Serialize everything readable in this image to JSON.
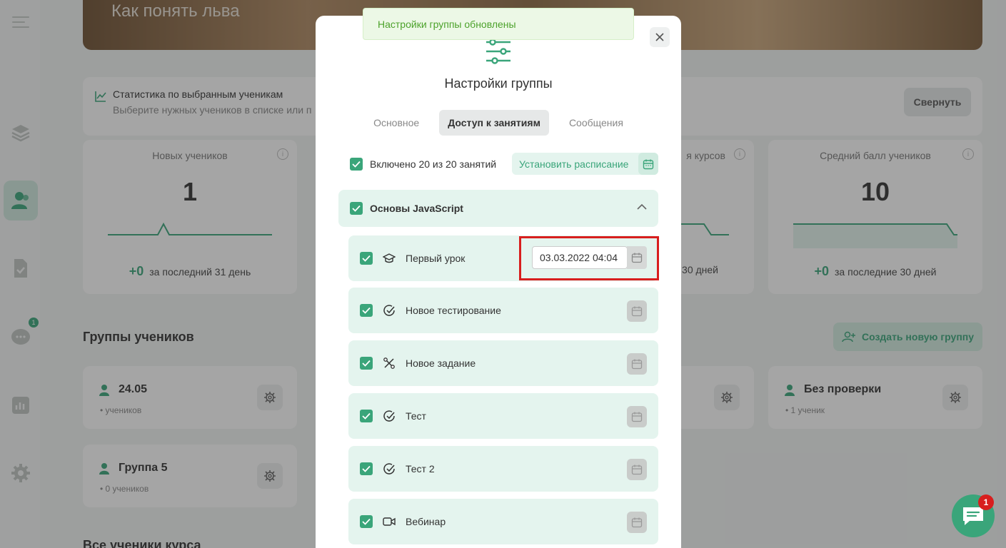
{
  "hero": {
    "title": "Как понять льва"
  },
  "sidebar": {
    "messages_badge": "1"
  },
  "stats": {
    "title": "Статистика по выбранным ученикам",
    "subtitle": "Выберите нужных учеников в списке или п",
    "collapse_label": "Свернуть",
    "cards": [
      {
        "title": "Новых учеников",
        "value": "1",
        "delta": "+0",
        "period": "за последний 31 день"
      },
      {
        "title": "я курсов",
        "value": "",
        "delta": "",
        "period": "30 дней"
      },
      {
        "title": "Средний балл учеников",
        "value": "10",
        "delta": "+0",
        "period": "за последние 30 дней"
      }
    ]
  },
  "groups": {
    "title": "Группы учеников",
    "create_label": "Создать новую группу",
    "items": [
      {
        "name": "24.05",
        "sub": "• учеников"
      },
      {
        "name": "Без проверки",
        "sub": "• 1 ученик"
      },
      {
        "name": "Группа 5",
        "sub": "• 0 учеников"
      }
    ]
  },
  "all_students": {
    "title": "Все ученики курса"
  },
  "toast": {
    "text": "Настройки группы обновлены"
  },
  "modal": {
    "title": "Настройки группы",
    "tabs": [
      {
        "label": "Основное"
      },
      {
        "label": "Доступ к занятиям"
      },
      {
        "label": "Сообщения"
      }
    ],
    "included_text": "Включено 20 из 20 занятий",
    "schedule_label": "Установить расписание",
    "section_title": "Основы JavaScript",
    "lessons": [
      {
        "title": "Первый урок",
        "date": "03.03.2022 04:04"
      },
      {
        "title": "Новое тестирование"
      },
      {
        "title": "Новое задание"
      },
      {
        "title": "Тест"
      },
      {
        "title": "Тест 2"
      },
      {
        "title": "Вебинар"
      }
    ]
  },
  "chat": {
    "badge": "1"
  },
  "colors": {
    "accent": "#3aa57a",
    "highlight": "#d81e1e",
    "toast_text": "#4ca22b"
  }
}
